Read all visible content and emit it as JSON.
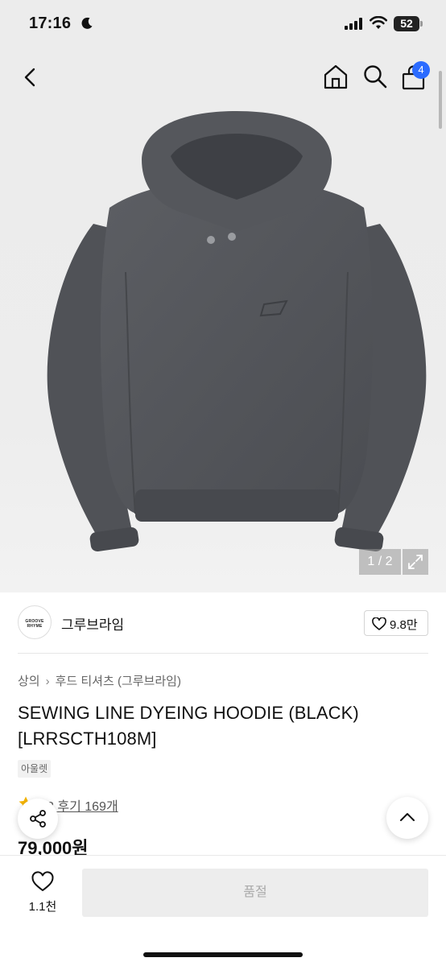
{
  "status_bar": {
    "time": "17:16",
    "battery": "52"
  },
  "nav": {
    "cart_badge": "4"
  },
  "gallery": {
    "page_counter": "1 / 2"
  },
  "brand": {
    "logo_text": "GROOVE RHYME",
    "name": "그루브라임",
    "likes": "9.8만"
  },
  "product": {
    "breadcrumb": [
      "상의",
      "후드 티셔츠 (그루브라임)"
    ],
    "title": "SEWING LINE DYEING HOODIE (BLACK) [LRRSCTH108M]",
    "tag": "아울렛",
    "rating_partial": "2",
    "reviews": "후기 169개",
    "price": "79,000원"
  },
  "bottom_bar": {
    "wish_count": "1.1천",
    "purchase_label": "품절"
  },
  "colors": {
    "accent_badge": "#2b6bff",
    "star": "#f5b400",
    "hoodie": "#53555a",
    "disabled_button": "#ededed"
  },
  "icons": [
    "back-icon",
    "home-icon",
    "search-icon",
    "bag-icon",
    "expand-icon",
    "heart-icon",
    "star-icon",
    "share-icon",
    "chevron-up-icon",
    "moon-icon",
    "signal-icon",
    "wifi-icon",
    "battery-icon"
  ]
}
